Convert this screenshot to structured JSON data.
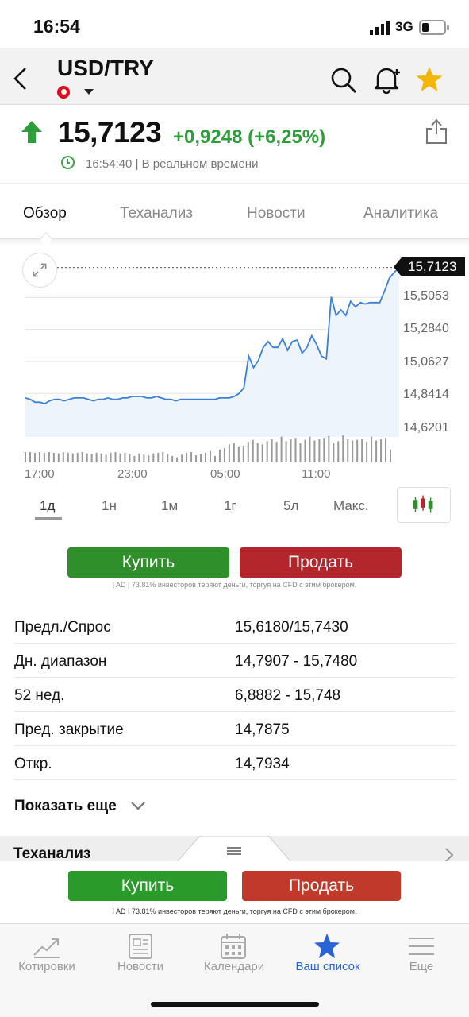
{
  "status_bar": {
    "time": "16:54",
    "network": "3G"
  },
  "header": {
    "title": "USD/TRY"
  },
  "quote": {
    "price": "15,7123",
    "change": "+0,9248 (+6,25%)",
    "time": "16:54:40",
    "time_note": "| В реальном времени"
  },
  "tabs": [
    "Обзор",
    "Теханализ",
    "Новости",
    "Аналитика"
  ],
  "chart_data": {
    "type": "line",
    "x_tick_labels": [
      "17:00",
      "23:00",
      "05:00",
      "11:00"
    ],
    "y_tick_labels": [
      "15,5053",
      "15,2840",
      "15,0627",
      "14,8414",
      "14,6201"
    ],
    "ylim": [
      14.54,
      15.76
    ],
    "last_price_label": "15,7123",
    "last_price": 15.7123,
    "series": [
      {
        "values": [
          14.81,
          14.8,
          14.78,
          14.78,
          14.77,
          14.79,
          14.8,
          14.8,
          14.79,
          14.8,
          14.81,
          14.81,
          14.81,
          14.8,
          14.79,
          14.8,
          14.8,
          14.81,
          14.8,
          14.8,
          14.81,
          14.81,
          14.82,
          14.82,
          14.82,
          14.81,
          14.81,
          14.82,
          14.81,
          14.8,
          14.8,
          14.79,
          14.8,
          14.8,
          14.8,
          14.8,
          14.8,
          14.8,
          14.8,
          14.8,
          14.81,
          14.81,
          14.81,
          14.82,
          14.84,
          14.88,
          15.1,
          15.02,
          15.07,
          15.16,
          15.2,
          15.16,
          15.16,
          15.22,
          15.14,
          15.2,
          15.21,
          15.12,
          15.16,
          15.24,
          15.18,
          15.1,
          15.08,
          15.51,
          15.38,
          15.42,
          15.38,
          15.48,
          15.44,
          15.47,
          15.46,
          15.47,
          15.47,
          15.47,
          15.55,
          15.64,
          15.68,
          15.71
        ]
      }
    ],
    "volume": [
      16,
      16,
      15,
      16,
      15,
      16,
      15,
      14,
      16,
      15,
      14,
      15,
      16,
      14,
      13,
      15,
      14,
      12,
      15,
      16,
      14,
      15,
      13,
      10,
      14,
      12,
      11,
      14,
      15,
      16,
      13,
      10,
      8,
      12,
      15,
      16,
      11,
      13,
      15,
      18,
      10,
      20,
      22,
      28,
      30,
      25,
      26,
      32,
      35,
      30,
      28,
      33,
      36,
      32,
      40,
      33,
      36,
      38,
      30,
      35,
      40,
      34,
      36,
      38,
      41,
      30,
      33,
      42,
      36,
      34,
      35,
      37,
      32,
      40,
      34,
      36,
      38,
      20
    ]
  },
  "ranges": [
    "1д",
    "1н",
    "1м",
    "1г",
    "5л",
    "Макс."
  ],
  "trade": {
    "buy": "Купить",
    "sell": "Продать",
    "disclaimer": "| AD | 73.81% инвесторов теряют деньги, торгуя на CFD с этим брокером."
  },
  "stats": [
    {
      "label": "Предл./Спрос",
      "value": "15,6180/15,7430"
    },
    {
      "label": "Дн. диапазон",
      "value": "14,7907 - 15,7480"
    },
    {
      "label": "52 нед.",
      "value": "6,8882 - 15,748"
    },
    {
      "label": "Пред. закрытие",
      "value": "14,7875"
    },
    {
      "label": "Откр.",
      "value": "14,7934"
    }
  ],
  "show_more": "Показать еще",
  "techanalysis_section": "Теханализ",
  "sticky_trade": {
    "buy": "Купить",
    "sell": "Продать",
    "disclaimer": "I AD I 73.81% инвесторов теряют деньги, торгуя на CFD с этим брокером."
  },
  "bottom_nav": [
    {
      "label": "Котировки",
      "icon": "chart-icon"
    },
    {
      "label": "Новости",
      "icon": "newspaper-icon"
    },
    {
      "label": "Календари",
      "icon": "calendar-icon"
    },
    {
      "label": "Ваш список",
      "icon": "star-icon"
    },
    {
      "label": "Еще",
      "icon": "menu-icon"
    }
  ],
  "colors": {
    "up": "#2e9e3a",
    "buy": "#2f8f2a",
    "sell": "#b3262b",
    "line": "#3d7fd9",
    "nav_active": "#2a63d6"
  }
}
